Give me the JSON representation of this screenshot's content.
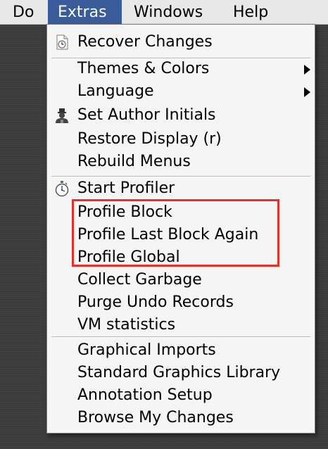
{
  "menubar": {
    "items": [
      {
        "label": "Do"
      },
      {
        "label": "Extras",
        "active": true
      },
      {
        "label": "Windows"
      },
      {
        "label": "Help"
      }
    ]
  },
  "extras_menu": {
    "items": [
      {
        "label": "Recover Changes",
        "icon": "recover-changes-icon"
      },
      {
        "label": "Themes & Colors",
        "submenu": true
      },
      {
        "label": "Language",
        "submenu": true
      },
      {
        "label": "Set Author Initials",
        "icon": "author-icon"
      },
      {
        "label": "Restore Display (r)"
      },
      {
        "label": "Rebuild Menus"
      },
      {
        "label": "Start Profiler",
        "icon": "stopwatch-icon"
      },
      {
        "label": "Profile Block"
      },
      {
        "label": "Profile Last Block Again"
      },
      {
        "label": "Profile Global"
      },
      {
        "label": "Collect Garbage"
      },
      {
        "label": "Purge Undo Records"
      },
      {
        "label": "VM statistics"
      },
      {
        "label": "Graphical Imports"
      },
      {
        "label": "Standard Graphics Library"
      },
      {
        "label": "Annotation Setup"
      },
      {
        "label": "Browse My Changes"
      }
    ]
  },
  "colors": {
    "menu_highlight": "#3a5c9a",
    "annotation_box": "#e8302b"
  }
}
